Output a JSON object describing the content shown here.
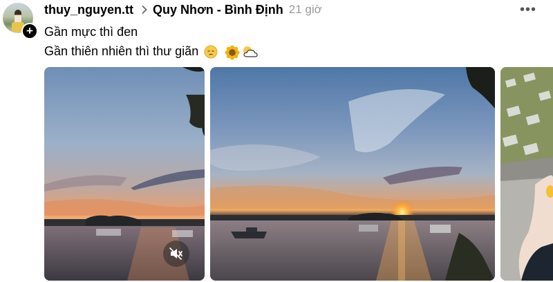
{
  "post": {
    "username": "thuy_nguyen.tt",
    "location": "Quy Nhơn - Bình Định",
    "time": "21 giờ",
    "more_label": "•••",
    "caption_line1": "Gần mực thì đen",
    "caption_line2": "Gần thiên nhiên thì thư giãn",
    "caption_emojis": [
      "pensive-face-icon",
      "sunflower-icon",
      "sun-behind-cloud-icon"
    ]
  },
  "media": [
    {
      "kind": "video",
      "description_icon": "mute-icon"
    },
    {
      "kind": "image"
    },
    {
      "kind": "image"
    }
  ],
  "colors": {
    "username": "#000000",
    "time": "#999999",
    "badge": "#000000"
  }
}
